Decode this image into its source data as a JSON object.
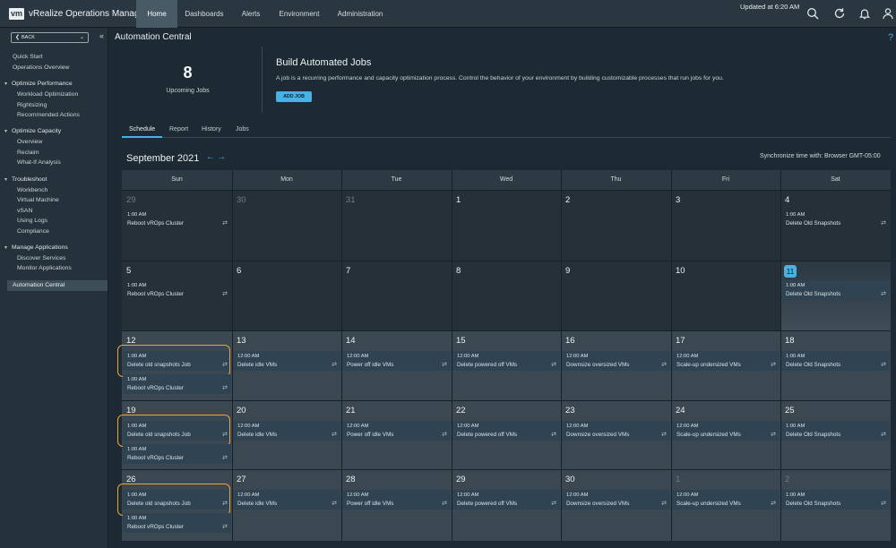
{
  "app": {
    "logo": "vm",
    "name": "vRealize Operations Manager",
    "nav": [
      "Home",
      "Dashboards",
      "Alerts",
      "Environment",
      "Administration"
    ],
    "active_nav": "Home",
    "updated": "Updated at 6:20 AM",
    "icons": [
      "search-icon",
      "refresh-icon",
      "bell-icon",
      "user-icon"
    ]
  },
  "sidebar": {
    "back": "BACK",
    "quick_start": "Quick Start",
    "operations_overview": "Operations Overview",
    "groups": [
      {
        "title": "Optimize Performance",
        "items": [
          "Workload Optimization",
          "Rightsizing",
          "Recommended Actions"
        ]
      },
      {
        "title": "Optimize Capacity",
        "items": [
          "Overview",
          "Reclaim",
          "What-If Analysis"
        ]
      },
      {
        "title": "Troubleshoot",
        "items": [
          "Workbench",
          "Virtual Machine",
          "vSAN",
          "Using Logs",
          "Compliance"
        ]
      },
      {
        "title": "Manage Applications",
        "items": [
          "Discover Services",
          "Monitor Applications"
        ]
      }
    ],
    "active": "Automation Central"
  },
  "page": {
    "title": "Automation Central",
    "help": "?",
    "upcoming_count": "8",
    "upcoming_label": "Upcoming Jobs",
    "build_title": "Build Automated Jobs",
    "build_desc": "A job is a recurring performance and capacity optimization process. Control the behavior of your environment by building customizable processes that run jobs for you.",
    "add_job": "ADD JOB",
    "tabs": [
      "Schedule",
      "Report",
      "History",
      "Jobs"
    ],
    "active_tab": "Schedule",
    "month": "September 2021",
    "sync": "Synchronize time with: Browser GMT-05:00"
  },
  "calendar": {
    "days": [
      "Sun",
      "Mon",
      "Tue",
      "Wed",
      "Thu",
      "Fri",
      "Sat"
    ],
    "today": "11",
    "weeks": [
      [
        {
          "d": "29",
          "dim": true,
          "events": [
            {
              "t": "1:00 AM",
              "n": "Reboot vROps Cluster"
            }
          ]
        },
        {
          "d": "30",
          "dim": true,
          "events": []
        },
        {
          "d": "31",
          "dim": true,
          "events": []
        },
        {
          "d": "1",
          "events": []
        },
        {
          "d": "2",
          "events": []
        },
        {
          "d": "3",
          "events": []
        },
        {
          "d": "4",
          "events": [
            {
              "t": "1:00 AM",
              "n": "Delete Old Snapshots"
            }
          ]
        }
      ],
      [
        {
          "d": "5",
          "events": [
            {
              "t": "1:00 AM",
              "n": "Reboot vROps Cluster"
            }
          ]
        },
        {
          "d": "6",
          "events": []
        },
        {
          "d": "7",
          "events": []
        },
        {
          "d": "8",
          "events": []
        },
        {
          "d": "9",
          "events": []
        },
        {
          "d": "10",
          "events": []
        },
        {
          "d": "11",
          "today": true,
          "events": [
            {
              "t": "1:00 AM",
              "n": "Delete Old Snapshots"
            }
          ]
        }
      ],
      [
        {
          "d": "12",
          "events": [
            {
              "t": "1:00 AM",
              "n": "Delete old snapshots Job",
              "hl": true
            },
            {
              "t": "1:00 AM",
              "n": "Reboot vROps Cluster"
            }
          ]
        },
        {
          "d": "13",
          "events": [
            {
              "t": "12:00 AM",
              "n": "Delete idle VMs"
            }
          ]
        },
        {
          "d": "14",
          "events": [
            {
              "t": "12:00 AM",
              "n": "Power off idle VMs"
            }
          ]
        },
        {
          "d": "15",
          "events": [
            {
              "t": "12:00 AM",
              "n": "Delete powered off VMs"
            }
          ]
        },
        {
          "d": "16",
          "events": [
            {
              "t": "12:00 AM",
              "n": "Downsize oversized VMs"
            }
          ]
        },
        {
          "d": "17",
          "events": [
            {
              "t": "12:00 AM",
              "n": "Scale-up undersized VMs"
            }
          ]
        },
        {
          "d": "18",
          "events": [
            {
              "t": "1:00 AM",
              "n": "Delete Old Snapshots"
            }
          ]
        }
      ],
      [
        {
          "d": "19",
          "events": [
            {
              "t": "1:00 AM",
              "n": "Delete old snapshots Job",
              "hl": true
            },
            {
              "t": "1:00 AM",
              "n": "Reboot vROps Cluster"
            }
          ]
        },
        {
          "d": "20",
          "events": [
            {
              "t": "12:00 AM",
              "n": "Delete idle VMs"
            }
          ]
        },
        {
          "d": "21",
          "events": [
            {
              "t": "12:00 AM",
              "n": "Power off idle VMs"
            }
          ]
        },
        {
          "d": "22",
          "events": [
            {
              "t": "12:00 AM",
              "n": "Delete powered off VMs"
            }
          ]
        },
        {
          "d": "23",
          "events": [
            {
              "t": "12:00 AM",
              "n": "Downsize oversized VMs"
            }
          ]
        },
        {
          "d": "24",
          "events": [
            {
              "t": "12:00 AM",
              "n": "Scale-up undersized VMs"
            }
          ]
        },
        {
          "d": "25",
          "events": [
            {
              "t": "1:00 AM",
              "n": "Delete Old Snapshots"
            }
          ]
        }
      ],
      [
        {
          "d": "26",
          "events": [
            {
              "t": "1:00 AM",
              "n": "Delete old snapshots Job",
              "hl": true
            },
            {
              "t": "1:00 AM",
              "n": "Reboot vROps Cluster"
            }
          ]
        },
        {
          "d": "27",
          "events": [
            {
              "t": "12:00 AM",
              "n": "Delete idle VMs"
            }
          ]
        },
        {
          "d": "28",
          "events": [
            {
              "t": "12:00 AM",
              "n": "Power off idle VMs"
            }
          ]
        },
        {
          "d": "29",
          "events": [
            {
              "t": "12:00 AM",
              "n": "Delete powered off VMs"
            }
          ]
        },
        {
          "d": "30",
          "events": [
            {
              "t": "12:00 AM",
              "n": "Downsize oversized VMs"
            }
          ]
        },
        {
          "d": "1",
          "dim": true,
          "events": [
            {
              "t": "12:00 AM",
              "n": "Scale-up undersized VMs"
            }
          ]
        },
        {
          "d": "2",
          "dim": true,
          "events": [
            {
              "t": "1:00 AM",
              "n": "Delete Old Snapshots"
            }
          ]
        }
      ]
    ]
  }
}
